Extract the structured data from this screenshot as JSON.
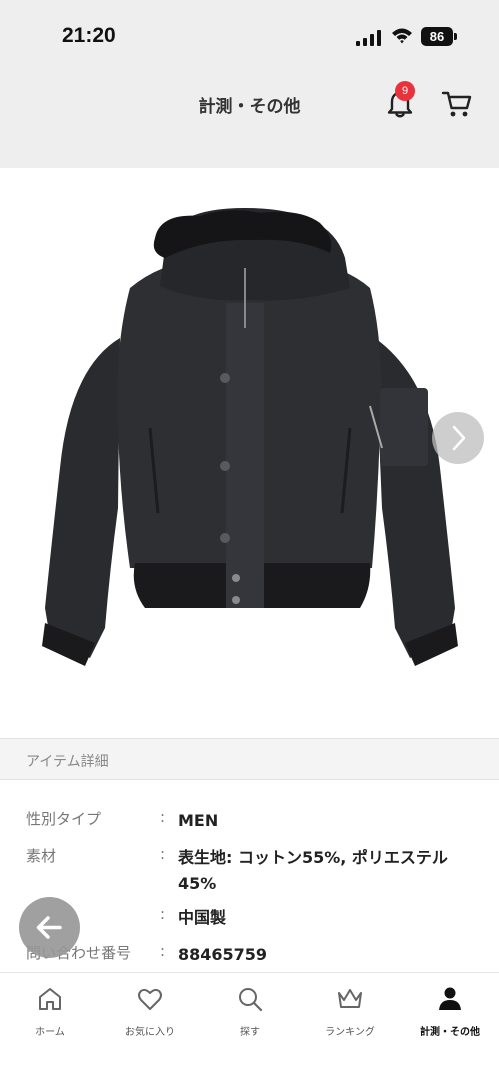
{
  "status_bar": {
    "time": "21:20",
    "battery": "86"
  },
  "header": {
    "title": "計測・その他",
    "notification_count": "9"
  },
  "product": {
    "image_icon": "bomber-jacket-image",
    "carousel_next_icon": "chevron-right-icon"
  },
  "details": {
    "section_title": "アイテム詳細",
    "rows": [
      {
        "label": "性別タイプ",
        "value": "MEN"
      },
      {
        "label": "素材",
        "value": "表生地: コットン55%, ポリエステル45%"
      },
      {
        "label": "",
        "value": "中国製"
      },
      {
        "label": "問い合わせ番号",
        "value": "88465759"
      }
    ]
  },
  "bottom_nav": {
    "items": [
      {
        "label": "ホーム",
        "icon": "home-icon"
      },
      {
        "label": "お気に入り",
        "icon": "heart-icon"
      },
      {
        "label": "探す",
        "icon": "search-icon"
      },
      {
        "label": "ランキング",
        "icon": "crown-icon"
      },
      {
        "label": "計測・その他",
        "icon": "person-icon",
        "active": true
      }
    ]
  },
  "colors": {
    "header_bg": "#eeeeee",
    "badge": "#e8323c",
    "text": "#222222",
    "muted": "#777777"
  }
}
